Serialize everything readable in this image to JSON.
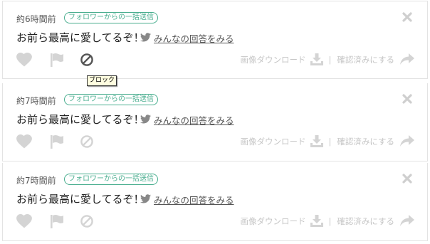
{
  "posts": [
    {
      "time": "約6時間前",
      "badge": "フォロワーからの一括送信",
      "message": "お前ら最高に愛してるぞ！",
      "twitter_link": "みんなの回答をみる",
      "download_label": "画像ダウンロード",
      "separator": "|",
      "confirm_label": "確認済みにする",
      "block_active": true
    },
    {
      "time": "約7時間前",
      "badge": "フォロワーからの一括送信",
      "message": "お前ら最高に愛してるぞ！",
      "twitter_link": "みんなの回答をみる",
      "download_label": "画像ダウンロード",
      "separator": "|",
      "confirm_label": "確認済みにする",
      "block_active": false
    },
    {
      "time": "約7時間前",
      "badge": "フォロワーからの一括送信",
      "message": "お前ら最高に愛してるぞ！",
      "twitter_link": "みんなの回答をみる",
      "download_label": "画像ダウンロード",
      "separator": "|",
      "confirm_label": "確認済みにする",
      "block_active": false
    }
  ],
  "tooltip": "ブロック",
  "colors": {
    "accent": "#4aae8f",
    "icon_muted": "#d4d4d4",
    "icon_active": "#555555",
    "twitter": "#888888"
  },
  "icons": [
    "heart-icon",
    "flag-icon",
    "block-icon",
    "close-icon",
    "twitter-icon",
    "download-icon",
    "share-icon"
  ]
}
